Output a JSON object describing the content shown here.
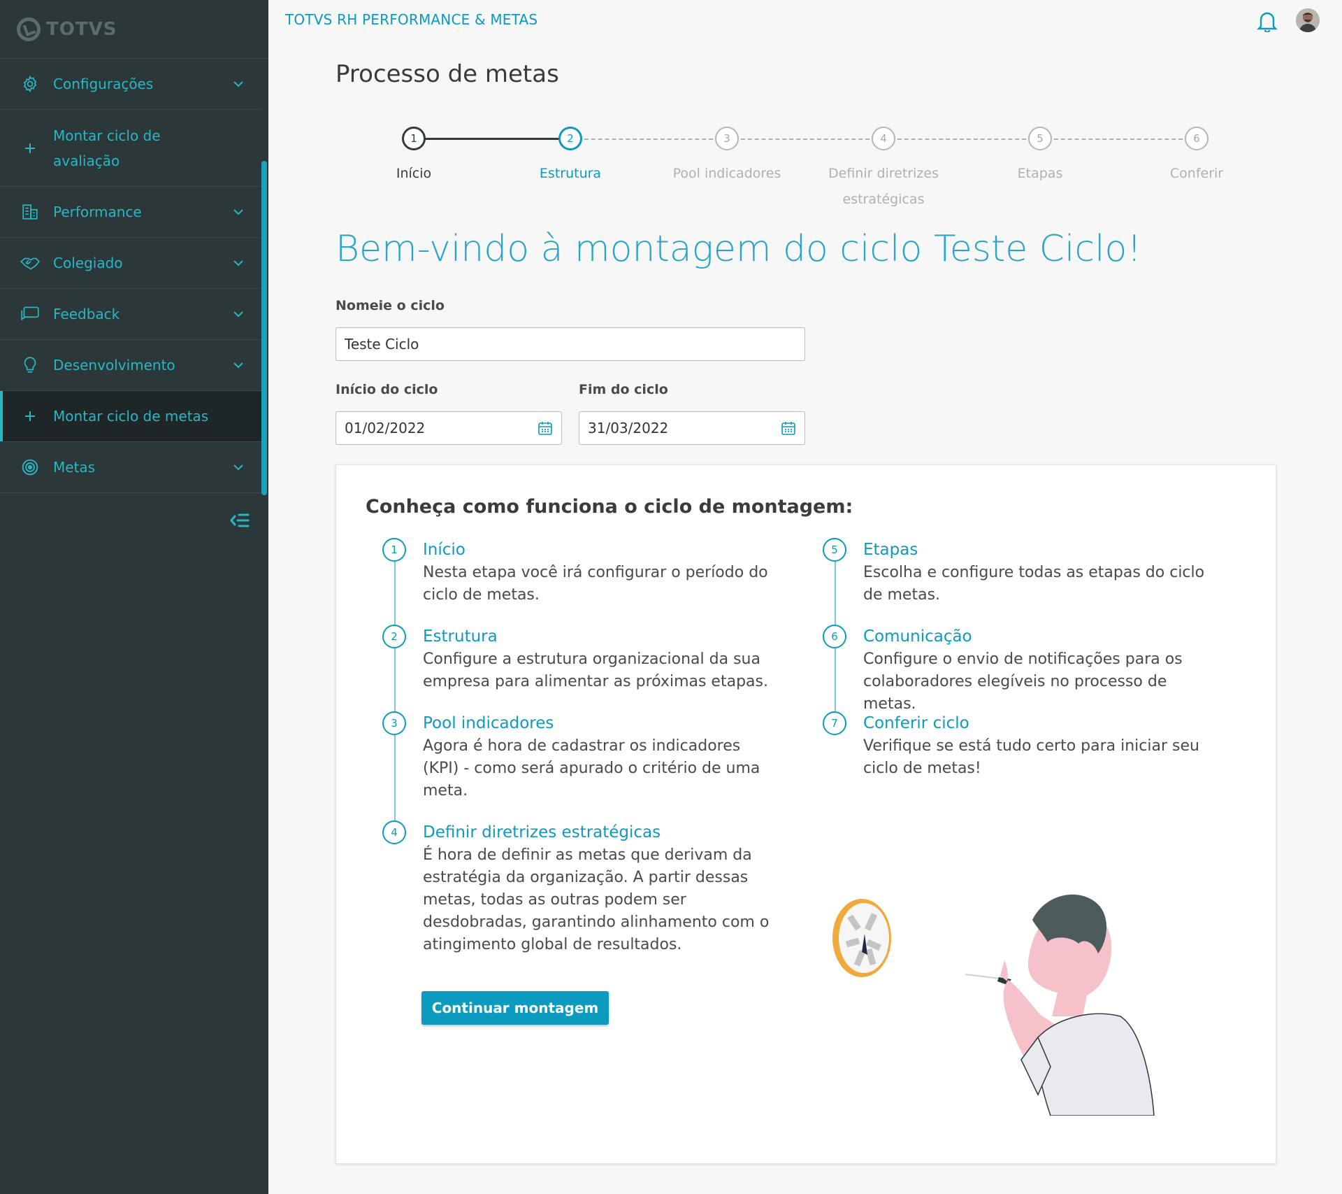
{
  "brand": {
    "logo_text": "TOTVS"
  },
  "header": {
    "app_title": "TOTVS RH PERFORMANCE & METAS"
  },
  "sidebar": {
    "items": [
      {
        "label": "Configurações",
        "icon": "gear-icon",
        "expandable": true
      },
      {
        "label": "Montar ciclo de avaliação",
        "icon": "plus-icon",
        "expandable": false
      },
      {
        "label": "Performance",
        "icon": "building-icon",
        "expandable": true
      },
      {
        "label": "Colegiado",
        "icon": "handshake-icon",
        "expandable": true
      },
      {
        "label": "Feedback",
        "icon": "chat-icon",
        "expandable": true
      },
      {
        "label": "Desenvolvimento",
        "icon": "lightbulb-icon",
        "expandable": true
      },
      {
        "label": "Montar ciclo de metas",
        "icon": "plus-icon",
        "expandable": false,
        "active": true
      },
      {
        "label": "Metas",
        "icon": "target-icon",
        "expandable": true
      }
    ]
  },
  "page": {
    "title": "Processo de metas"
  },
  "stepper": {
    "current": 2,
    "steps": [
      {
        "num": "1",
        "label": "Início",
        "status": "done"
      },
      {
        "num": "2",
        "label": "Estrutura",
        "status": "current"
      },
      {
        "num": "3",
        "label": "Pool indicadores",
        "status": "todo"
      },
      {
        "num": "4",
        "label": "Definir diretrizes estratégicas",
        "status": "todo"
      },
      {
        "num": "5",
        "label": "Etapas",
        "status": "todo"
      },
      {
        "num": "6",
        "label": "Conferir",
        "status": "todo"
      }
    ]
  },
  "welcome": "Bem-vindo à montagem do ciclo Teste Ciclo!",
  "form": {
    "name_label": "Nomeie o ciclo",
    "name_value": "Teste Ciclo",
    "start_label": "Início do ciclo",
    "start_value": "01/02/2022",
    "end_label": "Fim do ciclo",
    "end_value": "31/03/2022"
  },
  "info": {
    "title": "Conheça como funciona o ciclo de montagem:",
    "left": [
      {
        "num": "1",
        "title": "Início",
        "text": "Nesta etapa você irá configurar o período do ciclo de metas."
      },
      {
        "num": "2",
        "title": "Estrutura",
        "text": "Configure a estrutura organizacional da sua empresa para alimentar as próximas etapas."
      },
      {
        "num": "3",
        "title": "Pool indicadores",
        "text": "Agora é hora de cadastrar os indicadores (KPI) - como será apurado o critério de uma meta."
      },
      {
        "num": "4",
        "title": "Definir diretrizes estratégicas",
        "text": "É hora de definir as metas que derivam da estratégia da organização. A partir dessas metas, todas as outras podem ser desdobradas, garantindo alinhamento com o atingimento global de resultados."
      }
    ],
    "right": [
      {
        "num": "5",
        "title": "Etapas",
        "text": "Escolha e configure todas as etapas do ciclo de metas."
      },
      {
        "num": "6",
        "title": "Comunicação",
        "text": "Configure o envio de notificações para os colaboradores elegíveis no processo de metas."
      },
      {
        "num": "7",
        "title": "Conferir ciclo",
        "text": "Verifique se está tudo certo para iniciar seu ciclo de metas!"
      }
    ],
    "cta": "Continuar montagem"
  },
  "colors": {
    "accent": "#0c9abe",
    "sidebar_bg": "#2c3739",
    "sidebar_text": "#29b6c5"
  }
}
